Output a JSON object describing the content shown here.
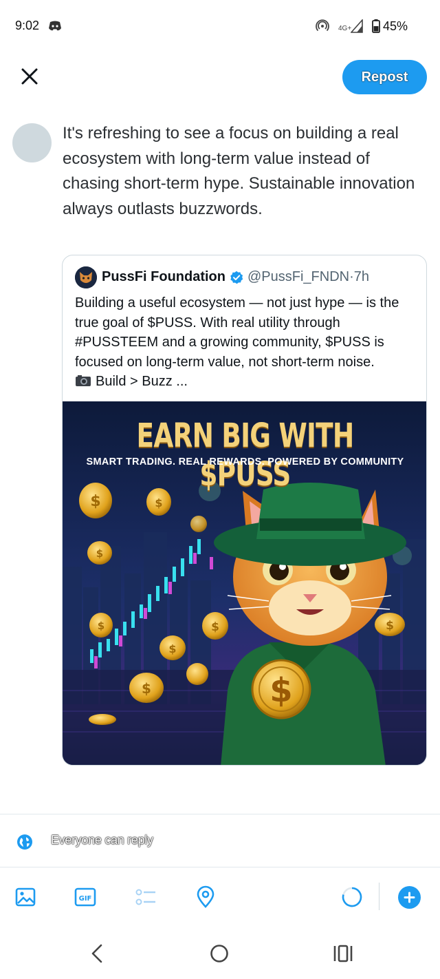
{
  "status_bar": {
    "time": "9:02",
    "network_label": "4G+",
    "battery": "45%",
    "icons": [
      "discord-icon",
      "hotspot-icon",
      "signal-icon",
      "battery-icon"
    ]
  },
  "compose": {
    "repost_label": "Repost",
    "text": "It's refreshing to see a focus on building a real ecosystem with long-term value instead of chasing short-term hype. Sustainable innovation always outlasts buzzwords."
  },
  "quote": {
    "name": "PussFi Foundation",
    "handle": "@PussFi_FNDN",
    "separator": " · ",
    "time": "7h",
    "body": "Building a useful ecosystem — not just hype — is the true goal of $PUSS. With real utility through #PUSSTEEM and a growing community, $PUSS is focused on long-term value, not short-term noise.",
    "body_tail": "Build > Buzz ...",
    "media": {
      "title": "EARN BIG WITH $PUSS",
      "subtitle": "SMART TRADING. REAL REWARDS. POWERED BY COMMUNITY"
    }
  },
  "reply_setting": "Everyone can reply",
  "toolbar": {
    "items": [
      "image-icon",
      "gif-icon",
      "poll-icon",
      "location-icon",
      "progress-ring",
      "add-icon"
    ]
  },
  "colors": {
    "accent": "#1d9bf0",
    "text": "#0f1419",
    "muted": "#536471",
    "border": "#cfd9de"
  }
}
